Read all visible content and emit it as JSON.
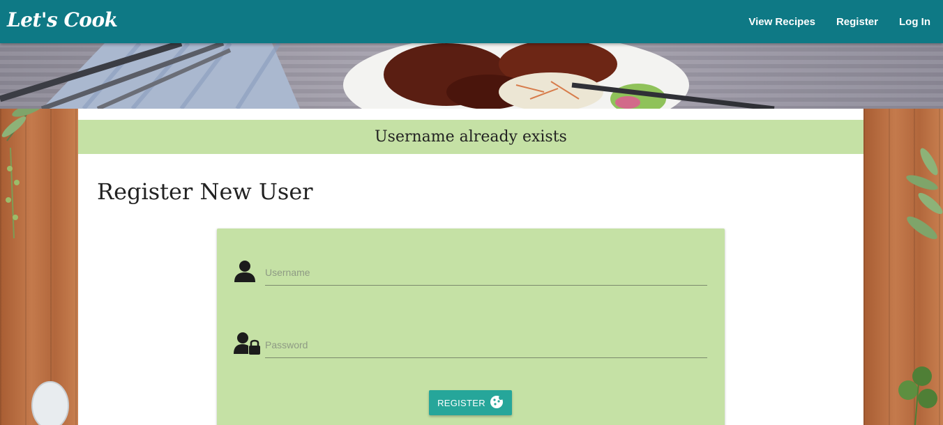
{
  "navbar": {
    "brand": "Let's Cook",
    "links": [
      "View Recipes",
      "Register",
      "Log In"
    ],
    "color": "#0e7985"
  },
  "flash": {
    "message": "Username already exists",
    "color": "#c5e1a5"
  },
  "page": {
    "title": "Register New User"
  },
  "form": {
    "username_placeholder": "Username",
    "password_placeholder": "Password",
    "submit_label": "REGISTER",
    "submit_icon": "cookie-icon",
    "button_color": "#26a69a"
  }
}
